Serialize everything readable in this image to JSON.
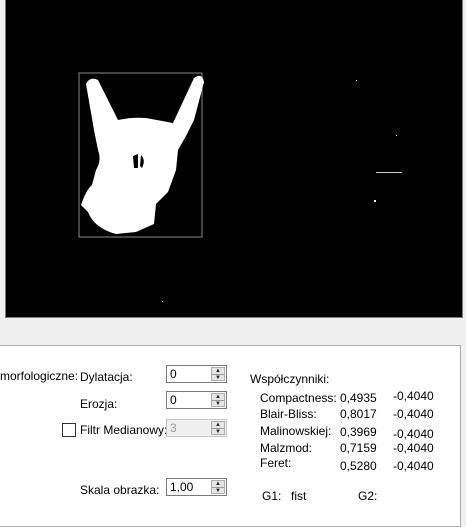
{
  "morph_label": "morfologiczne:",
  "dilation": {
    "label": "Dylatacja:",
    "value": "0"
  },
  "erosion": {
    "label": "Erozja:",
    "value": "0"
  },
  "median": {
    "label": "Filtr Medianowy:",
    "value": "3",
    "checked": false
  },
  "scale": {
    "label": "Skala obrazka:",
    "value": "1,00"
  },
  "coeffs": {
    "title": "Współczynniki:",
    "rows": [
      {
        "name": "Compactness:",
        "v1": "0,4935",
        "v2": "-0,4040"
      },
      {
        "name": "Blair-Bliss:",
        "v1": "0,8017",
        "v2": "-0,4040"
      },
      {
        "name": "Malinowskiej:",
        "v1": "0,3969",
        "v2": "-0,4040"
      },
      {
        "name": "Malzmod:",
        "v1": "0,7159",
        "v2": "-0,4040"
      },
      {
        "name": "Feret:",
        "v1": "0,5280",
        "v2": "-0,4040"
      }
    ]
  },
  "g1": {
    "label": "G1:",
    "value": "fist"
  },
  "g2": {
    "label": "G2:"
  }
}
